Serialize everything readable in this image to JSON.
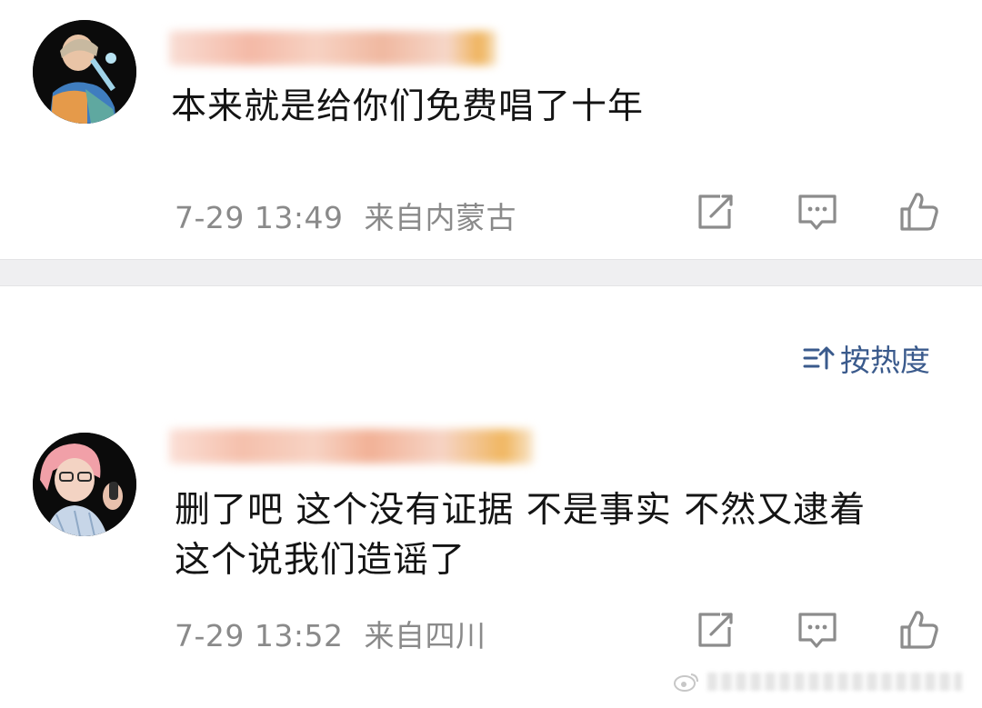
{
  "comments": [
    {
      "text": "本来就是给你们免费唱了十年",
      "time": "7-29 13:49",
      "location": "来自内蒙古"
    },
    {
      "text": "删了吧 这个没有证据 不是事实 不然又逮着\n这个说我们造谣了",
      "time": "7-29 13:52",
      "location": "来自四川"
    }
  ],
  "sort": {
    "label": "按热度",
    "icon": "sort-icon"
  },
  "icons": {
    "share": "share-icon",
    "comment": "comment-icon",
    "like": "like-icon"
  },
  "colors": {
    "meta_text": "#8a8a8a",
    "sort_link": "#3a5a8c",
    "divider": "#efeff1",
    "icon_gray": "#8c8c8c"
  }
}
